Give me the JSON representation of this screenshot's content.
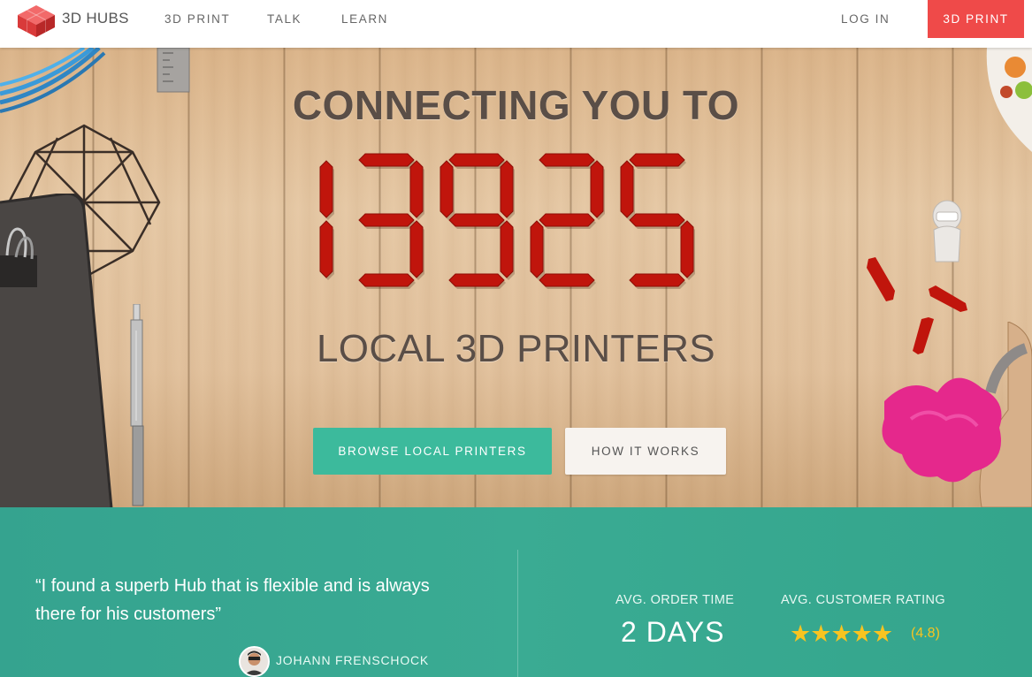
{
  "nav": {
    "brand": "3D HUBS",
    "links": [
      "3D PRINT",
      "TALK",
      "LEARN"
    ],
    "login": "LOG IN",
    "cta": "3D PRINT"
  },
  "hero": {
    "title": "CONNECTING YOU TO",
    "counter": "13925",
    "subtitle": "LOCAL 3D PRINTERS",
    "primary_button": "BROWSE LOCAL PRINTERS",
    "secondary_button": "HOW IT WORKS"
  },
  "testimonial": {
    "quote": "“I found a superb Hub that is flexible and is always there for his customers”",
    "author": "JOHANN FRENSCHOCK"
  },
  "stats": {
    "order_time_label": "AVG. ORDER TIME",
    "order_time_value": "2 DAYS",
    "rating_label": "AVG. CUSTOMER RATING",
    "rating_value": "(4.8)",
    "stars": 5
  },
  "colors": {
    "accent_red": "#ef4a49",
    "accent_green": "#3cba9c",
    "band_green": "#38a892",
    "digit_red": "#c0150c",
    "star_yellow": "#f8c420"
  },
  "icons": [
    "3d-hubs-cube-logo",
    "star-icon",
    "avatar"
  ]
}
